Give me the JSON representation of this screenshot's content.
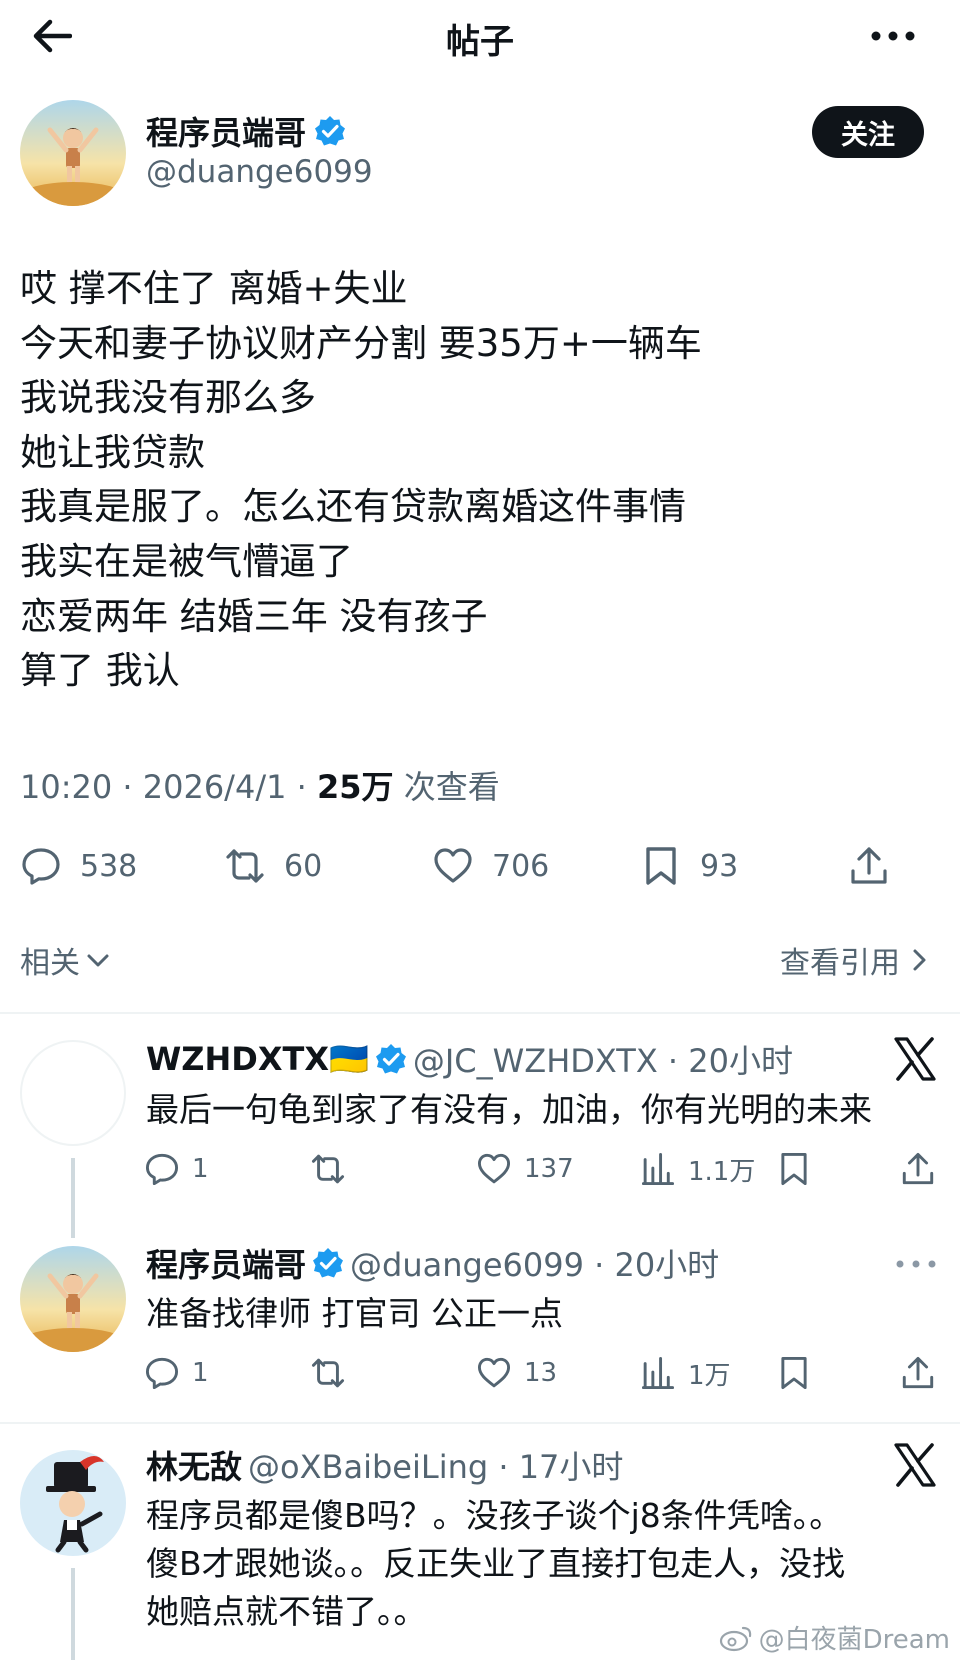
{
  "header": {
    "title": "帖子"
  },
  "post": {
    "author_name": "程序员端哥",
    "author_handle": "@duange6099",
    "follow_label": "关注",
    "lines": [
      "哎 撑不住了 离婚+失业",
      "今天和妻子协议财产分割 要35万+一辆车",
      "我说我没有那么多",
      "她让我贷款",
      "我真是服了。怎么还有贷款离婚这件事情",
      "我实在是被气懵逼了",
      "恋爱两年 结婚三年 没有孩子",
      "算了 我认"
    ],
    "time": "10:20 · 2026/4/1 · ",
    "views_count": "25万",
    "views_label": " 次查看",
    "replies": "538",
    "reposts": "60",
    "likes": "706",
    "bookmarks": "93"
  },
  "filters": {
    "related": "相关",
    "view_quotes": "查看引用"
  },
  "replies": [
    {
      "name": "WZHDXTX🇺🇦",
      "handle": "@JC_WZHDXTX · 20小时",
      "text": [
        "最后一句龟到家了有没有，加油，你有光明的未来"
      ],
      "replies": "1",
      "reposts": "",
      "likes": "137",
      "views": "1.1万"
    },
    {
      "name": "程序员端哥",
      "handle": "@duange6099 · 20小时",
      "text": [
        "准备找律师 打官司 公正一点"
      ],
      "replies": "1",
      "reposts": "",
      "likes": "13",
      "views": "1万"
    },
    {
      "name": "林无敌",
      "handle": "@oXBaibeiLing · 17小时",
      "text": [
        "程序员都是傻B吗？。没孩子谈个j8条件凭啥。。",
        "傻B才跟她谈。。反正失业了直接打包走人，没找",
        "她赔点就不错了。。"
      ]
    }
  ],
  "watermark": "@白夜菌Dream",
  "colors": {
    "accent": "#1d9bf0",
    "text": "#0f1419",
    "secondary": "#536471",
    "divider": "#eff3f4"
  }
}
